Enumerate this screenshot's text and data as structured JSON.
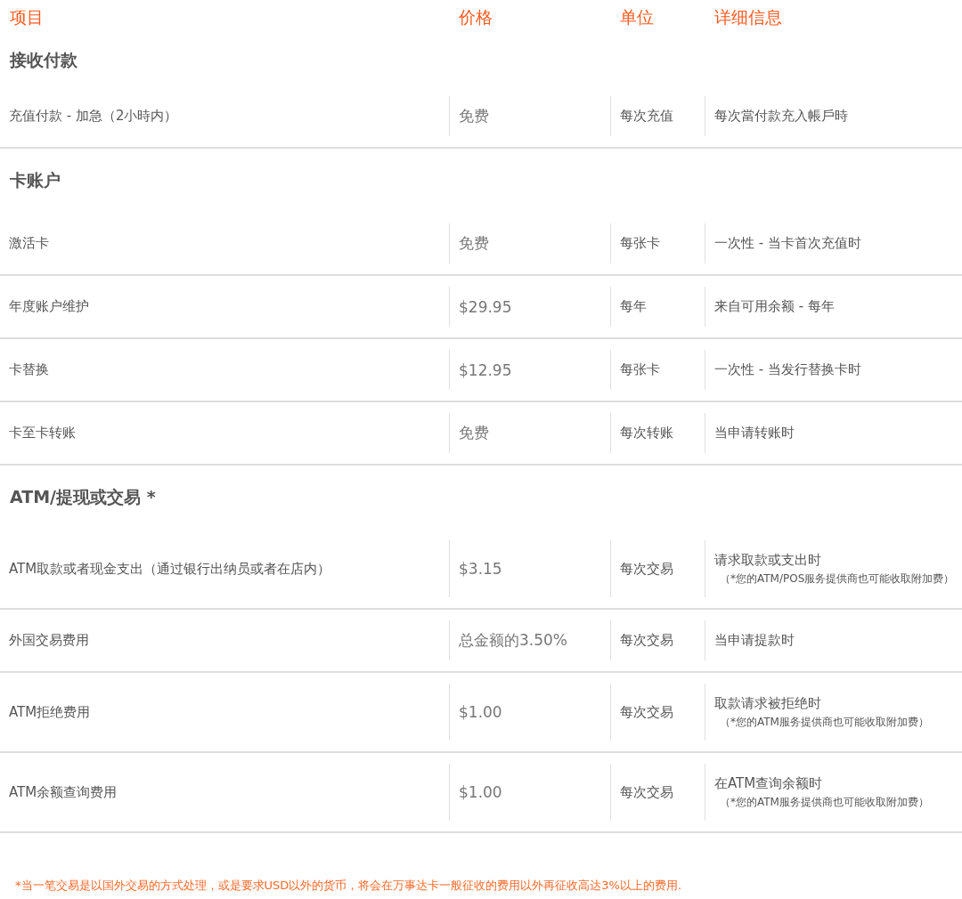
{
  "columns": [
    "项目",
    "价格",
    "单位",
    "详细信息"
  ],
  "sections": [
    {
      "title": "接收付款",
      "rows": [
        {
          "item": "充值付款 - 加急（2小時内）",
          "price": "免费",
          "unit": "每次充值",
          "detail": "每次當付款充入帳戶時"
        }
      ]
    },
    {
      "title": "卡账户",
      "rows": [
        {
          "item": "激活卡",
          "price": "免费",
          "unit": "每张卡",
          "detail": "一次性 - 当卡首次充值时"
        },
        {
          "item": "年度账户维护",
          "price": "$29.95",
          "unit": "每年",
          "detail": "来自可用余额 - 每年"
        },
        {
          "item": "卡替换",
          "price": "$12.95",
          "unit": "每张卡",
          "detail": "一次性 - 当发行替换卡时"
        },
        {
          "item": "卡至卡转账",
          "price": "免费",
          "unit": "每次转账",
          "detail": "当申请转账时"
        }
      ]
    },
    {
      "title": "ATM/提现或交易 *",
      "rows": [
        {
          "item": "ATM取款或者现金支出（通过银行出纳员或者在店内）",
          "price": "$3.15",
          "unit": "每次交易",
          "detail": "请求取款或支出时",
          "note": "（*您的ATM/POS服务提供商也可能收取附加费）"
        },
        {
          "item": "外国交易费用",
          "price": "总金额的3.50%",
          "unit": "每次交易",
          "detail": "当申请提款时"
        },
        {
          "item": "ATM拒绝费用",
          "price": "$1.00",
          "unit": "每次交易",
          "detail": "取款请求被拒绝时",
          "note": "（*您的ATM服务提供商也可能收取附加费）"
        },
        {
          "item": "ATM余额查询费用",
          "price": "$1.00",
          "unit": "每次交易",
          "detail": "在ATM查询余额时",
          "note": "（*您的ATM服务提供商也可能收取附加费）"
        }
      ]
    }
  ],
  "footnote": "*当一笔交易是以国外交易的方式处理，或是要求USD以外的货币，将会在万事达卡一般征收的费用以外再征收高达3%以上的费用."
}
